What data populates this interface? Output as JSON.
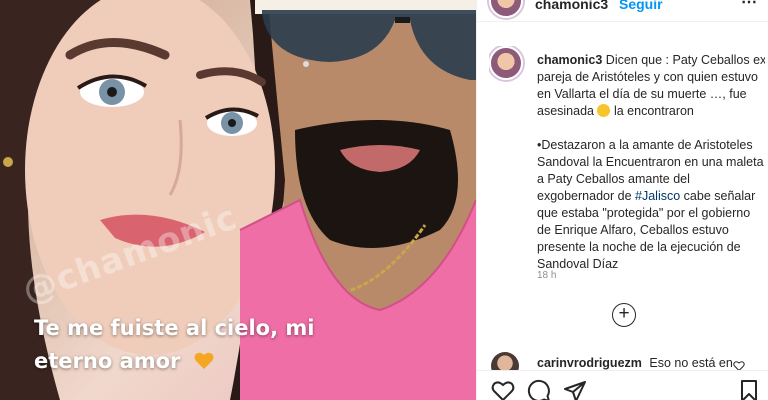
{
  "header": {
    "username": "chamonic3",
    "follow_label": "Seguir",
    "more_label": "⋯"
  },
  "photo": {
    "caption_line1": "Te me fuiste al cielo, mi",
    "caption_line2": "eterno amor",
    "watermark": "@chamonic"
  },
  "post": {
    "username": "chamonic3",
    "text_part1": "Dicen que : Paty Ceballos ex pareja de Aristóteles y con quien estuvo en Vallarta el día de su muerte …, fue asesinada",
    "text_part2": "la encontraron",
    "paragraph2_before": "•Destazaron a la amante de Aristoteles Sandoval la Encuentraron en una maleta a Paty Ceballos amante del exgobernador de",
    "hashtag": "#Jalisco",
    "paragraph2_after": "cabe señalar que estaba \"protegida\" por el gobierno de Enrique Alfaro, Ceballos estuvo presente la noche de la ejecución de Sandoval Díaz",
    "time": "18 h",
    "load_more": "+"
  },
  "comment": {
    "username": "carinvrodriguezm",
    "text": "Eso no está en"
  },
  "icons": {
    "like": "heart-icon",
    "comment": "comment-icon",
    "share": "share-icon",
    "save": "bookmark-icon",
    "caption_emoji": "orange-heart-icon",
    "text_emoji": "sad-face-icon"
  },
  "colors": {
    "link": "#0095f6",
    "hashtag": "#00376b",
    "muted": "#8e8e8e",
    "text": "#262626"
  }
}
